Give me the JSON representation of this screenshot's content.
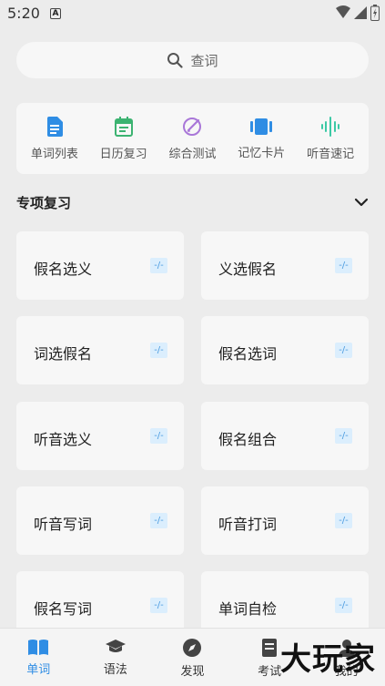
{
  "status_bar": {
    "time": "5:20",
    "notification_letter": "A"
  },
  "search": {
    "placeholder": "查词"
  },
  "quick_actions": [
    {
      "label": "单词列表",
      "icon": "document-icon",
      "color": "#2f8de4"
    },
    {
      "label": "日历复习",
      "icon": "calendar-icon",
      "color": "#3cb371"
    },
    {
      "label": "综合测试",
      "icon": "test-icon",
      "color": "#a977d8"
    },
    {
      "label": "记忆卡片",
      "icon": "cards-icon",
      "color": "#2f8de4"
    },
    {
      "label": "听音速记",
      "icon": "audio-wave-icon",
      "color": "#3cc9a5"
    }
  ],
  "section": {
    "title": "专项复习"
  },
  "review_cards": [
    {
      "label": "假名选义",
      "badge": "-/-"
    },
    {
      "label": "义选假名",
      "badge": "-/-"
    },
    {
      "label": "词选假名",
      "badge": "-/-"
    },
    {
      "label": "假名选词",
      "badge": "-/-"
    },
    {
      "label": "听音选义",
      "badge": "-/-"
    },
    {
      "label": "假名组合",
      "badge": "-/-"
    },
    {
      "label": "听音写词",
      "badge": "-/-"
    },
    {
      "label": "听音打词",
      "badge": "-/-"
    },
    {
      "label": "假名写词",
      "badge": "-/-"
    },
    {
      "label": "单词自检",
      "badge": "-/-"
    }
  ],
  "tabs": [
    {
      "label": "单词",
      "active": true
    },
    {
      "label": "语法",
      "active": false
    },
    {
      "label": "发现",
      "active": false
    },
    {
      "label": "考试",
      "active": false
    },
    {
      "label": "我的",
      "active": false
    }
  ],
  "watermark": "大玩家",
  "colors": {
    "accent": "#2f8de4",
    "card_bg": "#f7f7f7",
    "page_bg": "#ececec"
  }
}
